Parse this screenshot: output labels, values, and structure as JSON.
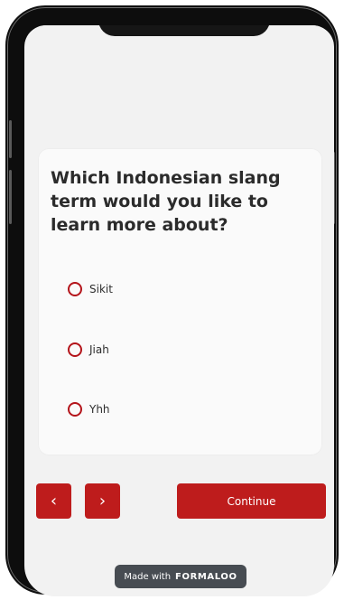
{
  "form": {
    "question": "Which Indonesian slang term would you like to learn more about?",
    "options": [
      {
        "label": "Sikit",
        "selected": false
      },
      {
        "label": "Jiah",
        "selected": false
      },
      {
        "label": "Yhh",
        "selected": false
      }
    ],
    "accent_color": "#be1c1c"
  },
  "navigation": {
    "prev_icon": "chevron-left-icon",
    "prev_glyph": "‹",
    "next_icon": "chevron-right-icon",
    "next_glyph": "›",
    "continue_label": "Continue"
  },
  "branding": {
    "made_with": "Made with",
    "brand": "FORMALOO",
    "badge_color": "#474c52"
  }
}
